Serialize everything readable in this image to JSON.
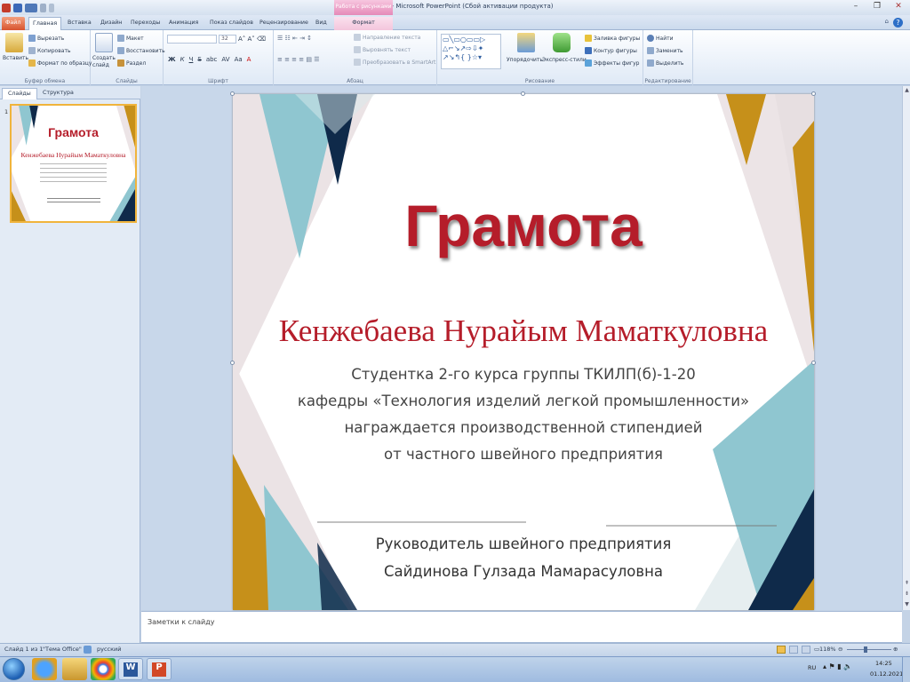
{
  "app": {
    "title": "грамота 2 - Microsoft PowerPoint (Сбой активации продукта)",
    "context_tab_group": "Работа с рисунками"
  },
  "tabs": [
    {
      "label": "Файл"
    },
    {
      "label": "Главная"
    },
    {
      "label": "Вставка"
    },
    {
      "label": "Дизайн"
    },
    {
      "label": "Переходы"
    },
    {
      "label": "Анимация"
    },
    {
      "label": "Показ слайдов"
    },
    {
      "label": "Рецензирование"
    },
    {
      "label": "Вид"
    },
    {
      "label": "Формат"
    }
  ],
  "ribbon": {
    "clipboard": {
      "paste": "Вставить",
      "cut": "Вырезать",
      "copy": "Копировать",
      "format_painter": "Формат по образцу",
      "label": "Буфер обмена"
    },
    "slides": {
      "new_slide": "Создать слайд",
      "layout": "Макет",
      "reset": "Восстановить",
      "section": "Раздел",
      "label": "Слайды"
    },
    "font": {
      "label": "Шрифт",
      "size": "32"
    },
    "paragraph": {
      "text_direction": "Направление текста",
      "align_text": "Выровнять текст",
      "smartart": "Преобразовать в SmartArt",
      "label": "Абзац"
    },
    "drawing": {
      "arrange": "Упорядочить",
      "quick_styles": "Экспресс-стили",
      "fill": "Заливка фигуры",
      "outline": "Контур фигуры",
      "effects": "Эффекты фигур",
      "label": "Рисование"
    },
    "editing": {
      "find": "Найти",
      "replace": "Заменить",
      "select": "Выделить",
      "label": "Редактирование"
    }
  },
  "left_pane": {
    "tabs": [
      "Слайды",
      "Структура"
    ],
    "slide_number": "1"
  },
  "slide": {
    "title": "Грамота",
    "name": "Кенжебаева Нурайым Маматкуловна",
    "lines": [
      "Студентка 2-го курса группы ТКИЛП(б)-1-20",
      "кафедры «Технология изделий легкой промышленности»",
      "награждается производственной стипендией",
      "от частного швейного предприятия"
    ],
    "manager_lines": [
      "Руководитель швейного предприятия",
      "Сайдинова Гулзада Мамарасуловна"
    ]
  },
  "thumbnail": {
    "title": "Грамота",
    "name": "Кенжебаева Нурайым Маматкуловна"
  },
  "notes": {
    "placeholder": "Заметки к слайду"
  },
  "status": {
    "slide": "Слайд 1 из 1",
    "theme": "\"Тема Office\"",
    "language": "русский",
    "zoom": "118%"
  },
  "tray": {
    "lang": "RU",
    "time": "14:25",
    "date": "01.12.2021"
  },
  "colors": {
    "title_red": "#b51d2a",
    "navy": "#0f2a4a",
    "teal": "#8fc6d0",
    "gold": "#c6901a",
    "file_tab": "#d8542f"
  }
}
